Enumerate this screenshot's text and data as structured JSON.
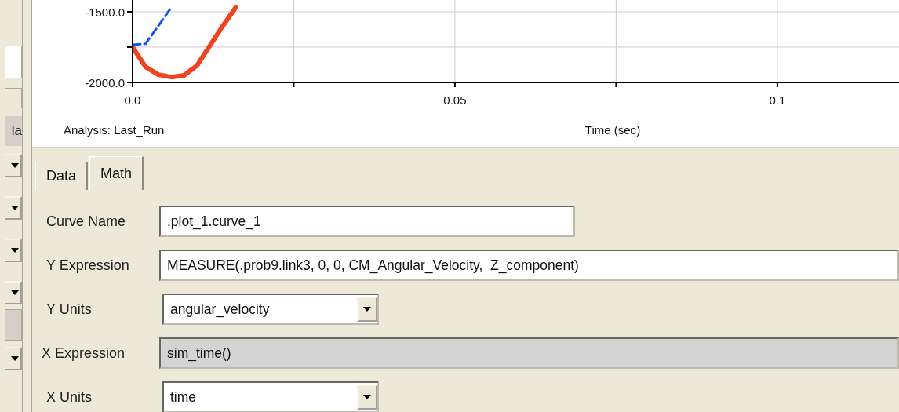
{
  "left_panel": {
    "cut_label": "la"
  },
  "plot": {
    "analysis_label": "Analysis:",
    "analysis_name": "Last_Run",
    "chart_data": {
      "type": "line",
      "xlabel": "Time (sec)",
      "xlim": [
        0,
        0.119
      ],
      "ylim": [
        -2000,
        -1417
      ],
      "grid": true,
      "xticks": [
        {
          "value": 0,
          "label": "0.0"
        },
        {
          "value": 0.05,
          "label": "0.05"
        },
        {
          "value": 0.1,
          "label": "0.1"
        }
      ],
      "yticks": [
        {
          "value": -1500,
          "label": "-1500.0"
        },
        {
          "value": -2000,
          "label": "-2000.0"
        }
      ],
      "x": [
        0,
        0.002,
        0.004,
        0.006,
        0.008,
        0.01,
        0.012,
        0.014,
        0.016
      ],
      "series": [
        {
          "color": "#ee4422",
          "line_style": "solid",
          "values": [
            -1750,
            -1890,
            -1945,
            -1962,
            -1950,
            -1880,
            -1740,
            -1600,
            -1470
          ]
        },
        {
          "color": "#1155ee",
          "line_style": "dashed",
          "values": [
            -1733,
            -1727,
            -1600,
            -1470,
            null,
            null,
            null,
            null,
            null
          ]
        }
      ]
    }
  },
  "tabs": [
    {
      "label": "Data",
      "selected": false
    },
    {
      "label": "Math",
      "selected": true
    }
  ],
  "form": [
    {
      "kind": "text",
      "label": "Curve Name",
      "value": ".plot_1.curve_1",
      "disabled": false
    },
    {
      "kind": "text",
      "label": "Y Expression",
      "value": "MEASURE(.prob9.link3, 0, 0, CM_Angular_Velocity,  Z_component)",
      "disabled": false
    },
    {
      "kind": "select",
      "label": "Y Units",
      "value": "angular_velocity"
    },
    {
      "kind": "text",
      "label": "X Expression",
      "value": "sim_time()",
      "disabled": true
    },
    {
      "kind": "select",
      "label": "X Units",
      "value": "time"
    }
  ]
}
